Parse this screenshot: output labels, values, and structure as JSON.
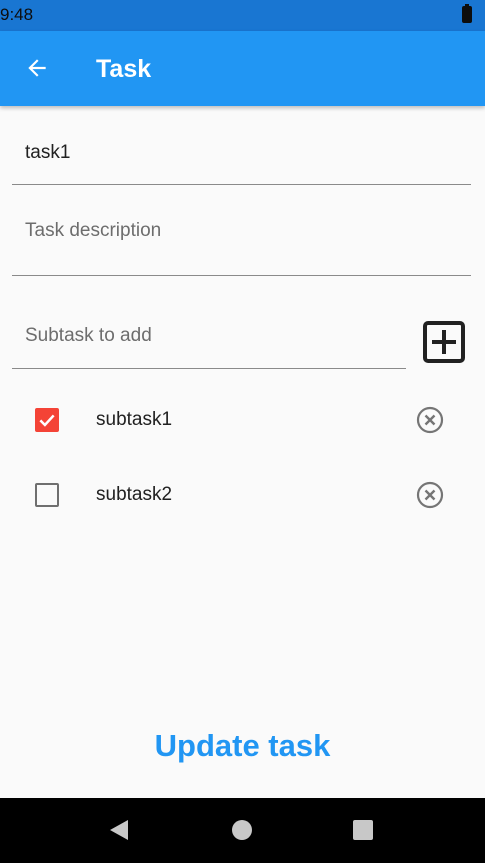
{
  "status_bar": {
    "time": "9:48"
  },
  "app_bar": {
    "title": "Task"
  },
  "form": {
    "task_title_value": "task1",
    "task_description_placeholder": "Task description",
    "task_description_value": "",
    "subtask_placeholder": "Subtask to add",
    "subtask_value": ""
  },
  "subtasks": [
    {
      "label": "subtask1",
      "checked": true
    },
    {
      "label": "subtask2",
      "checked": false
    }
  ],
  "actions": {
    "update_label": "Update task"
  },
  "icons": {
    "back": "arrow-back-icon",
    "add": "add-box-icon",
    "remove": "cancel-circle-outline-icon",
    "check": "check-icon",
    "nav_back": "triangle-back-icon",
    "nav_home": "circle-home-icon",
    "nav_recents": "square-recents-icon",
    "battery": "battery-icon"
  },
  "colors": {
    "status_bar": "#1976d2",
    "app_bar": "#2196f3",
    "accent": "#2196f3",
    "checkbox_checked": "#f44336",
    "background": "#fafafa",
    "nav_bar": "#000000"
  }
}
